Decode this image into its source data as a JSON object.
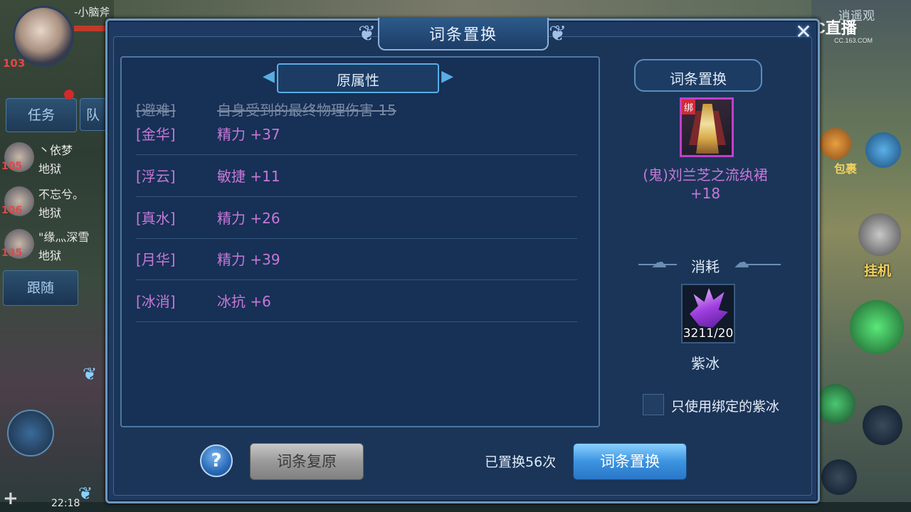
{
  "hud": {
    "player_name": "-小脑斧",
    "player_level": "103",
    "quest_tab": "任务",
    "team_tab": "队",
    "team": [
      {
        "level": "105",
        "name": "丶依梦",
        "location": "地狱"
      },
      {
        "level": "106",
        "name": "不忘兮。",
        "location": "地狱"
      },
      {
        "level": "135",
        "name": "\"缘灬深雪",
        "location": "地狱"
      }
    ],
    "follow_btn": "跟随",
    "time": "22:18",
    "map_name": "逍遥观",
    "bag_label": "包裹",
    "auto_label": "挂机"
  },
  "watermark": {
    "brand": "CC直播",
    "url": "CC.163.COM"
  },
  "dialog": {
    "title": "词条置换",
    "close_icon": "close-icon"
  },
  "attributes": {
    "header": "原属性",
    "removed": {
      "tag": "[避难]",
      "value": "自身受到的最终物理伤害 15"
    },
    "rows": [
      {
        "tag": "[金华]",
        "value": "精力 +37"
      },
      {
        "tag": "[浮云]",
        "value": "敏捷 +11"
      },
      {
        "tag": "[真水]",
        "value": "精力 +26"
      },
      {
        "tag": "[月华]",
        "value": "精力 +39"
      },
      {
        "tag": "[冰消]",
        "value": "冰抗 +6"
      }
    ]
  },
  "replace_panel": {
    "header": "词条置换",
    "bind_tag": "绑",
    "item_name_line1": "(鬼)刘兰芝之流纨裙",
    "item_name_line2": "+18",
    "cost_label": "消耗",
    "material_count": "3211/20",
    "material_name": "紫冰",
    "checkbox_label": "只使用绑定的紫冰",
    "checkbox_checked": false
  },
  "footer": {
    "help": "?",
    "restore_btn": "词条复原",
    "replace_count": "已置换56次",
    "replace_btn": "词条置换"
  },
  "colors": {
    "purple_text": "#c678d8",
    "panel_bg": "#1b3558",
    "accent_blue": "#58aee4"
  }
}
